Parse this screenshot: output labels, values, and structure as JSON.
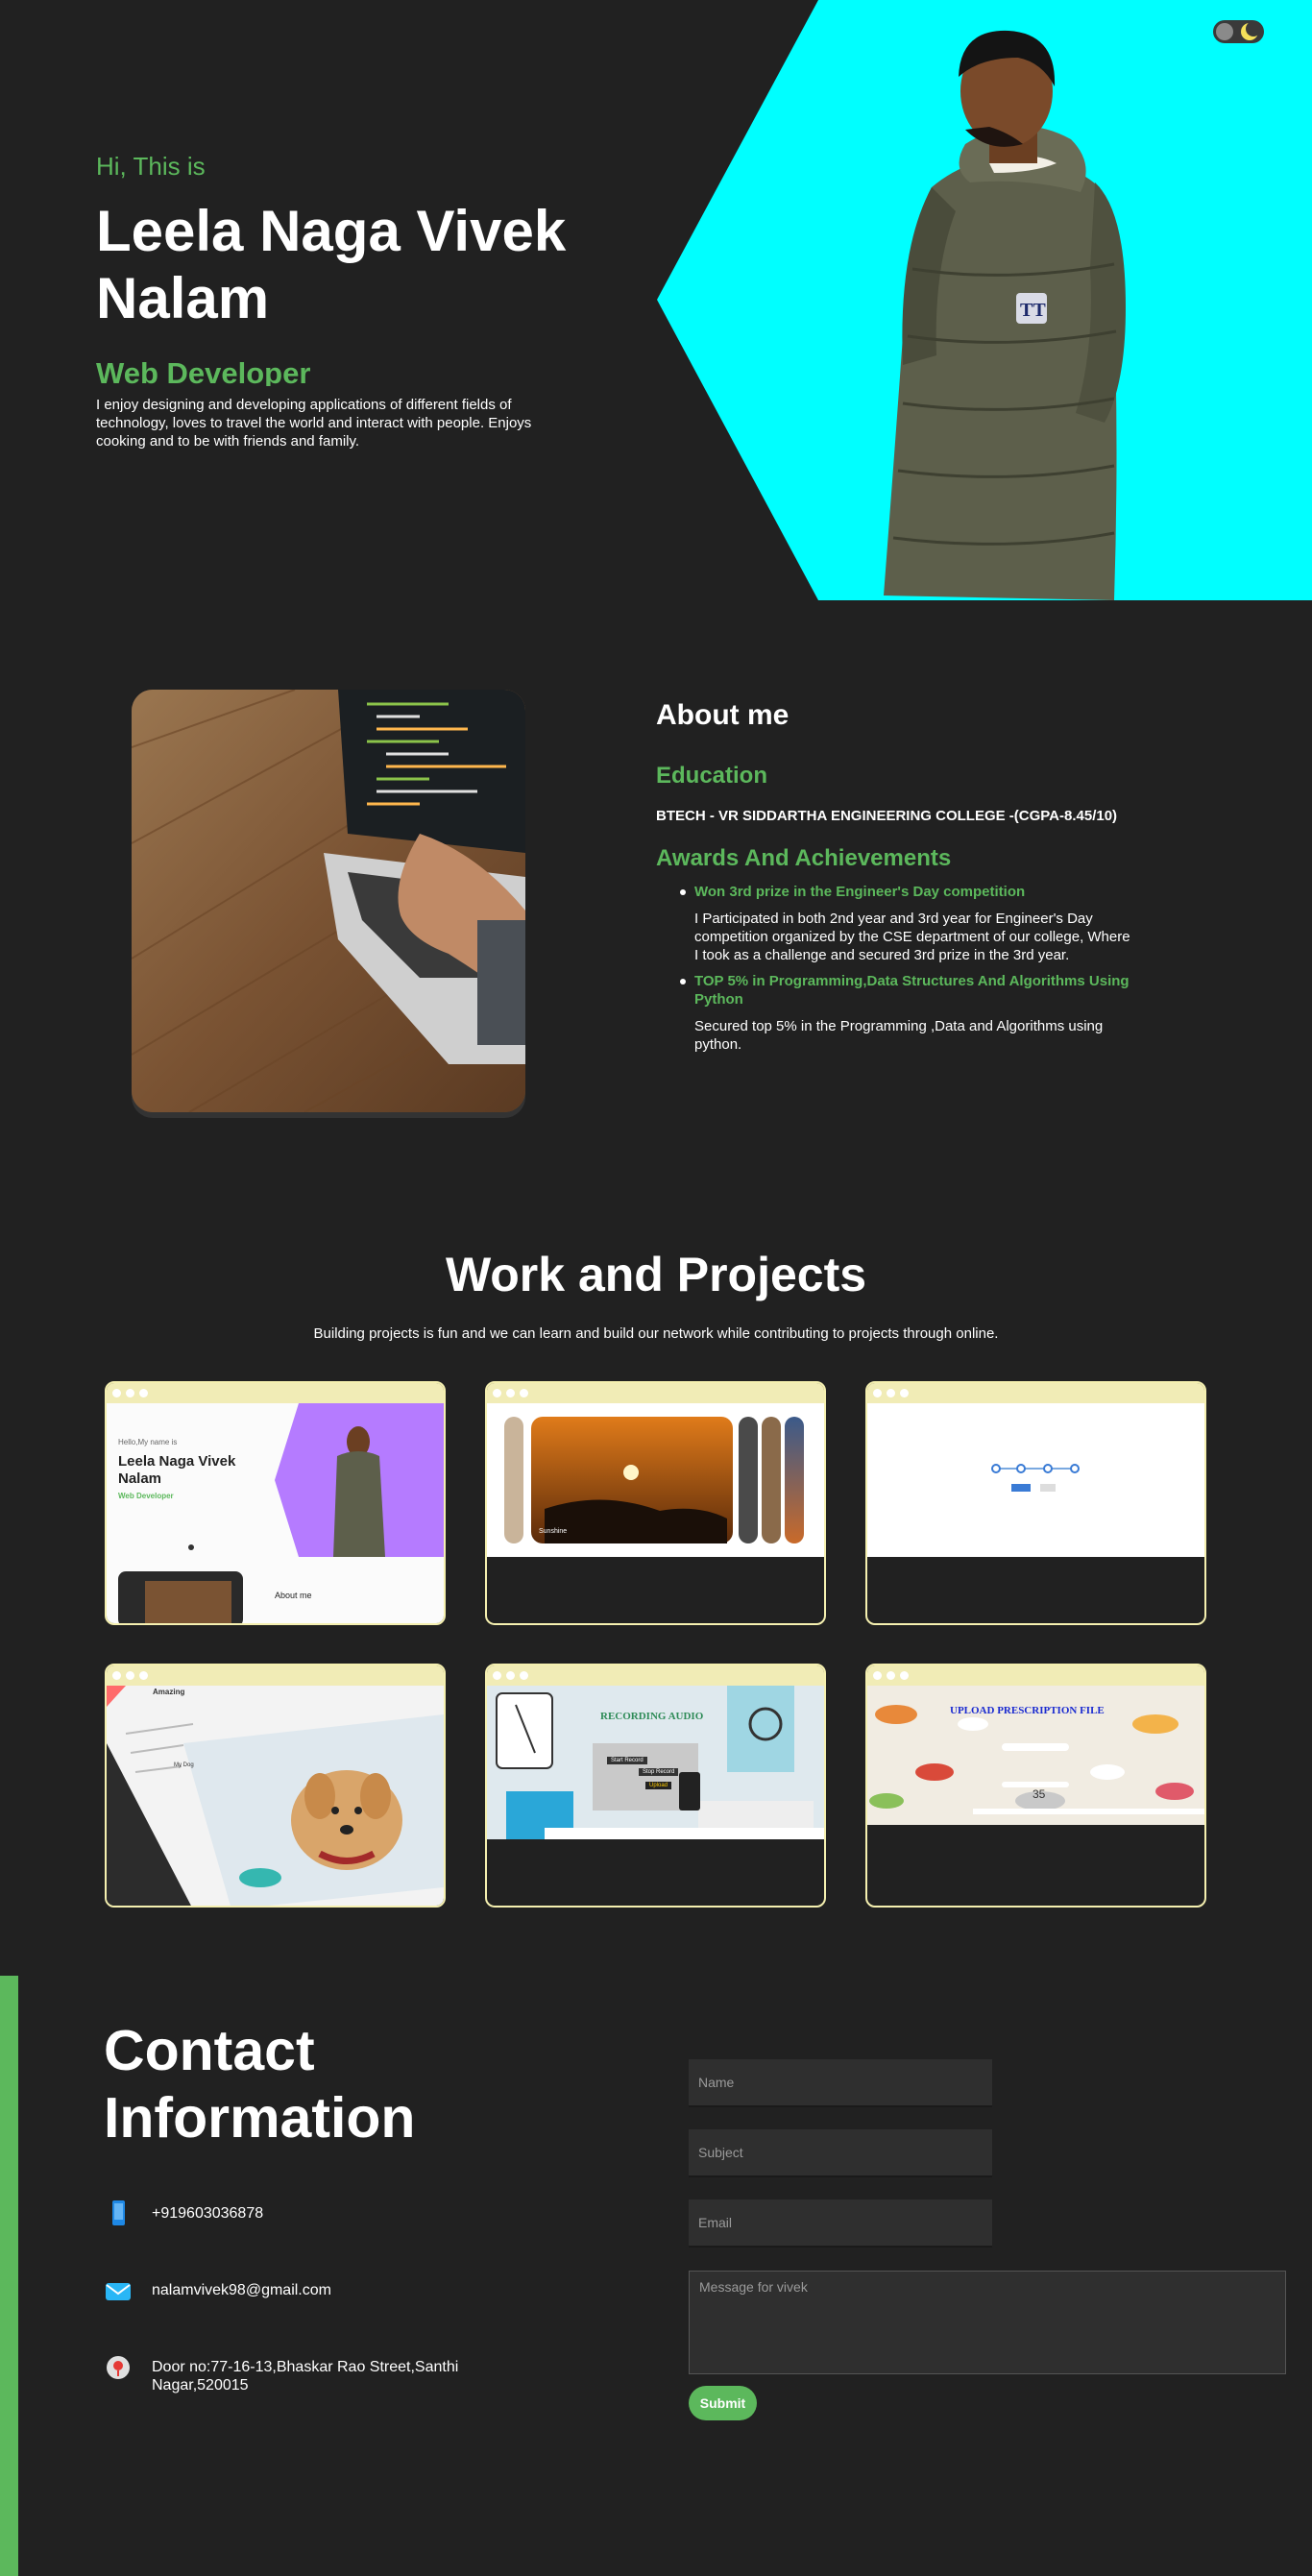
{
  "theme": {
    "accent": "#5cb85c",
    "background": "#212121",
    "hero_cyan": "#00FFFF",
    "card_border": "#f5f0b0"
  },
  "header": {
    "theme_toggle_icon": "moon-icon"
  },
  "hero": {
    "greeting": "Hi, This is",
    "name": "Leela Naga Vivek Nalam",
    "role": "Web Developer",
    "intro": "I enjoy designing and developing applications of different fields of technology, loves to travel the world and interact with people. Enjoys cooking and to be with friends and family."
  },
  "about": {
    "title": "About me",
    "education_heading": "Education",
    "education": "BTECH - VR SIDDARTHA ENGINEERING COLLEGE -(CGPA-8.45/10)",
    "awards_heading": "Awards And Achievements",
    "awards": [
      {
        "title": "Won 3rd prize in the Engineer's Day competition",
        "description": "I Participated in both 2nd year and 3rd year for Engineer's Day competition organized by the CSE department of our college, Where I took as a challenge and secured 3rd prize in the 3rd year."
      },
      {
        "title": "TOP 5% in Programming,Data Structures And Algorithms Using Python",
        "description": "Secured top 5% in the Programming ,Data and Algorithms using python."
      }
    ]
  },
  "work": {
    "title": "Work and Projects",
    "subtitle": "Building projects is fun and we can learn and build our network while contributing to projects through online.",
    "projects": [
      {
        "kind": "portfolio",
        "lines": [
          "Hello,My name is",
          "Leela Naga Vivek",
          "Nalam",
          "Web Developer",
          "About me"
        ]
      },
      {
        "kind": "gallery",
        "lines": [
          "Sunshine"
        ]
      },
      {
        "kind": "stepper",
        "lines": []
      },
      {
        "kind": "article",
        "lines": [
          "Amazing",
          "My Dog"
        ]
      },
      {
        "kind": "recording",
        "lines": [
          "RECORDING AUDIO",
          "Start Record",
          "Stop Record",
          "Upload"
        ]
      },
      {
        "kind": "prescription",
        "lines": [
          "UPLOAD PRESCRIPTION FILE",
          "35"
        ]
      }
    ]
  },
  "contact": {
    "title_line1": "Contact",
    "title_line2": "Information",
    "phone": "+919603036878",
    "email": "nalamvivek98@gmail.com",
    "address": "Door no:77-16-13,Bhaskar Rao Street,Santhi Nagar,520015",
    "icons": [
      "phone-icon",
      "mail-icon",
      "location-icon"
    ],
    "form": {
      "name_placeholder": "Name",
      "subject_placeholder": "Subject",
      "email_placeholder": "Email",
      "message_placeholder": "Message for vivek",
      "submit_label": "Submit"
    }
  }
}
